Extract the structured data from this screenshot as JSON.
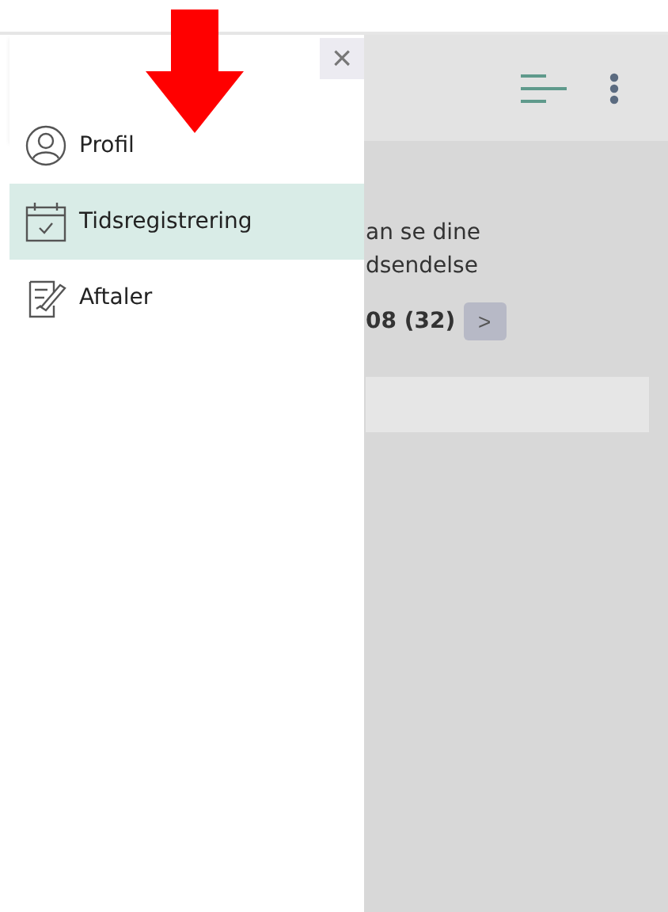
{
  "background": {
    "intro_lines": [
      "an se dine",
      "dsendelse"
    ],
    "count": "08 (32)",
    "next_button": ">"
  },
  "drawer": {
    "close": "×",
    "items": [
      {
        "label": "Profil",
        "selected": false
      },
      {
        "label": "Tidsregistrering",
        "selected": true
      },
      {
        "label": "Aftaler",
        "selected": false
      }
    ]
  }
}
